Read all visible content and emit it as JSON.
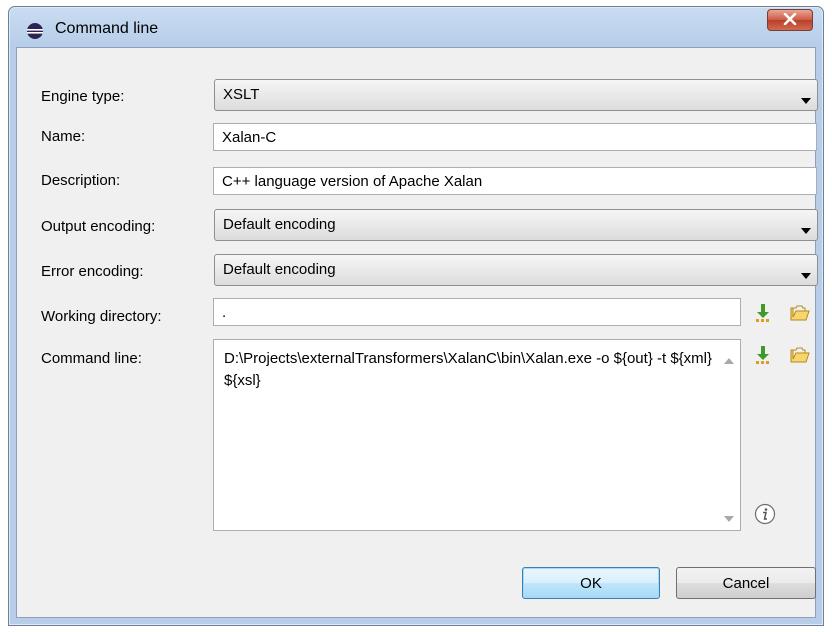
{
  "window": {
    "title": "Command line"
  },
  "form": {
    "engine_type": {
      "label": "Engine type:",
      "value": "XSLT"
    },
    "name": {
      "label": "Name:",
      "value": "Xalan-C"
    },
    "description": {
      "label": "Description:",
      "value": "C++ language version of Apache Xalan"
    },
    "output_encoding": {
      "label": "Output encoding:",
      "value": "Default encoding"
    },
    "error_encoding": {
      "label": "Error encoding:",
      "value": "Default encoding"
    },
    "working_directory": {
      "label": "Working directory:",
      "value": "."
    },
    "command_line": {
      "label": "Command line:",
      "value": "D:\\Projects\\externalTransformers\\XalanC\\bin\\Xalan.exe -o ${out} -t ${xml} ${xsl}"
    }
  },
  "buttons": {
    "ok": "OK",
    "cancel": "Cancel"
  },
  "icons": {
    "app": "eclipse-icon",
    "close": "close-icon",
    "insert_editor_variables": "insert-variables-icon",
    "browse": "open-folder-icon",
    "info": "info-icon"
  },
  "colors": {
    "title_bar": "#c4d8f0",
    "dialog_bg": "#f0f0f0",
    "close_button": "#c9503c"
  }
}
